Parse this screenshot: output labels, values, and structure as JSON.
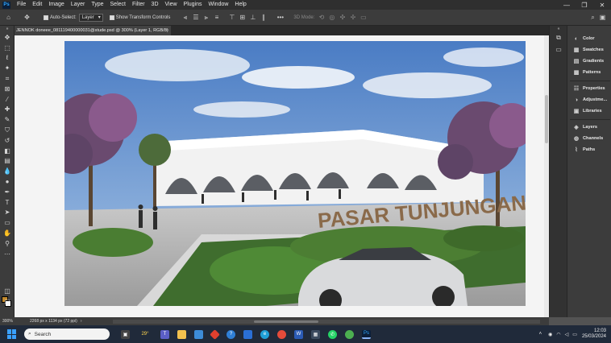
{
  "menubar": {
    "logo": "Ps",
    "items": [
      "File",
      "Edit",
      "Image",
      "Layer",
      "Type",
      "Select",
      "Filter",
      "3D",
      "View",
      "Plugins",
      "Window",
      "Help"
    ]
  },
  "options": {
    "auto_select_label": "Auto-Select:",
    "auto_select_target": "Layer",
    "show_transform_label": "Show Transform Controls",
    "mode_3d_label": "3D Mode:"
  },
  "document": {
    "tab_title": "JENNOK doneee_081119400000031@stude.psd @ 300% (Layer 1, RGB/8)",
    "zoom": "300%",
    "doc_info": "2268 px x 1134 px (72 ppi)",
    "sign_text": "PASAR TUNJUNGAN"
  },
  "panels": {
    "items": [
      "Color",
      "Swatches",
      "Gradients",
      "Patterns",
      "Properties",
      "Adjustme...",
      "Libraries",
      "Layers",
      "Channels",
      "Paths"
    ],
    "icons": [
      "color-wheel-icon",
      "swatches-icon",
      "gradients-icon",
      "patterns-icon",
      "properties-icon",
      "adjustments-icon",
      "libraries-icon",
      "layers-icon",
      "channels-icon",
      "paths-icon"
    ]
  },
  "taskbar": {
    "search_placeholder": "Search",
    "weather": "29°",
    "time": "12:03",
    "date": "25/03/2024"
  },
  "colors": {
    "foreground": "#c38a2c",
    "background": "#ffffff",
    "accent": "#31a8ff"
  }
}
